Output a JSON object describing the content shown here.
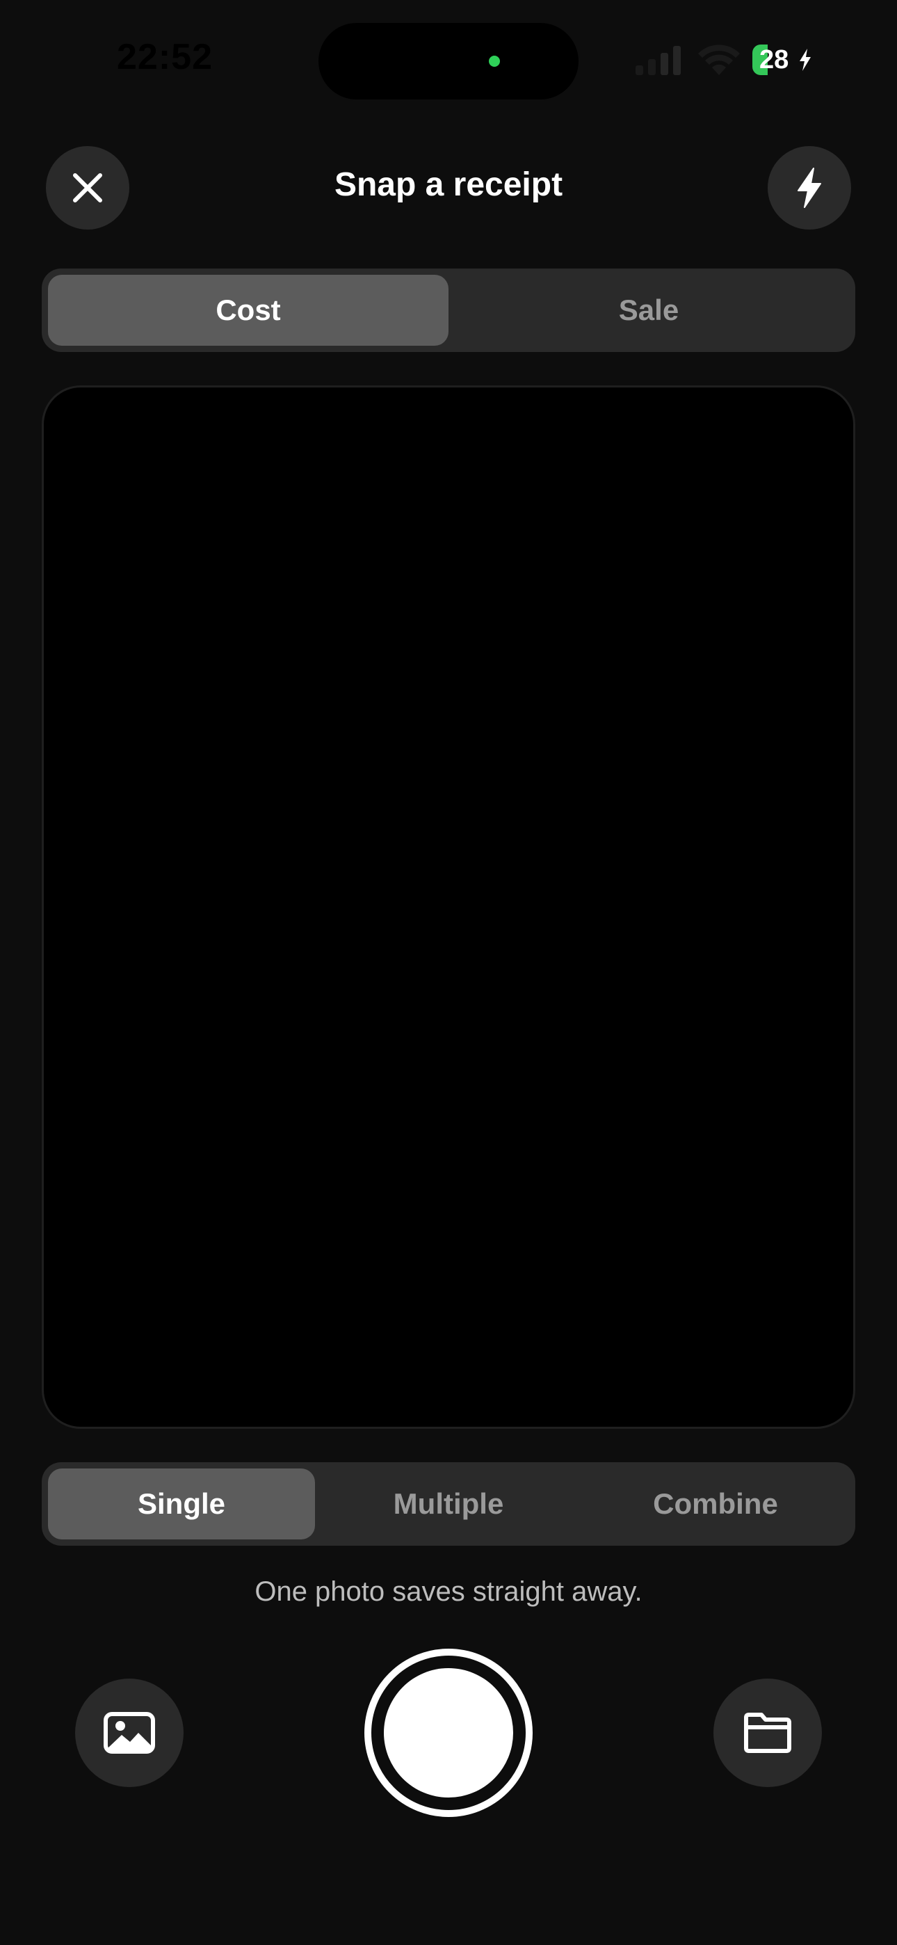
{
  "status_bar": {
    "time": "22:52",
    "battery_level": "28",
    "battery_charging": true,
    "camera_indicator_color": "#2fd159"
  },
  "header": {
    "title": "Snap a receipt",
    "close_icon": "close-icon",
    "flash_icon": "lightning-bolt-icon"
  },
  "type_toggle": {
    "options": [
      "Cost",
      "Sale"
    ],
    "selected": "Cost"
  },
  "mode_toggle": {
    "options": [
      "Single",
      "Multiple",
      "Combine"
    ],
    "selected": "Single"
  },
  "helper_text": "One photo saves straight away.",
  "bottom_bar": {
    "gallery_icon": "photo-gallery-icon",
    "files_icon": "folder-icon"
  },
  "colors": {
    "background": "#0d0d0d",
    "surface": "#2a2a2a",
    "active_segment": "#5c5c5c"
  }
}
